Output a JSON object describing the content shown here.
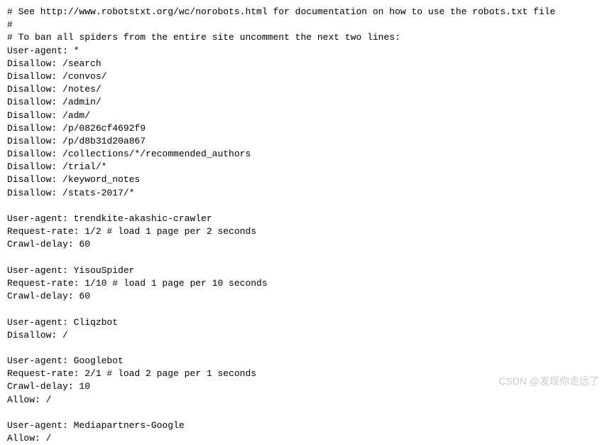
{
  "lines": [
    "# See http://www.robotstxt.org/wc/norobots.html for documentation on how to use the robots.txt file",
    "#",
    "# To ban all spiders from the entire site uncomment the next two lines:",
    "User-agent: *",
    "Disallow: /search",
    "Disallow: /convos/",
    "Disallow: /notes/",
    "Disallow: /admin/",
    "Disallow: /adm/",
    "Disallow: /p/0826cf4692f9",
    "Disallow: /p/d8b31d20a867",
    "Disallow: /collections/*/recommended_authors",
    "Disallow: /trial/*",
    "Disallow: /keyword_notes",
    "Disallow: /stats-2017/*",
    "",
    "User-agent: trendkite-akashic-crawler",
    "Request-rate: 1/2 # load 1 page per 2 seconds",
    "Crawl-delay: 60",
    "",
    "User-agent: YisouSpider",
    "Request-rate: 1/10 # load 1 page per 10 seconds",
    "Crawl-delay: 60",
    "",
    "User-agent: Cliqzbot",
    "Disallow: /",
    "",
    "User-agent: Googlebot",
    "Request-rate: 2/1 # load 2 page per 1 seconds",
    "Crawl-delay: 10",
    "Allow: /",
    "",
    "User-agent: Mediapartners-Google",
    "Allow: /"
  ],
  "watermark": "CSDN @发现你走远了"
}
